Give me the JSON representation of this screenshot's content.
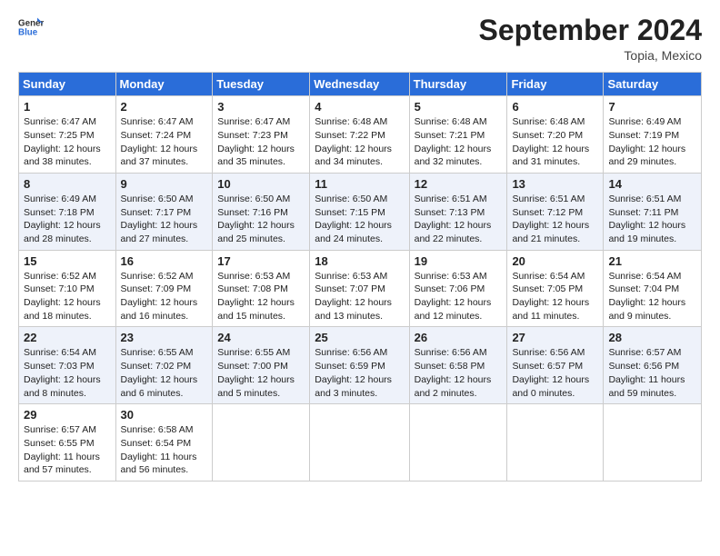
{
  "header": {
    "logo_general": "General",
    "logo_blue": "Blue",
    "month_year": "September 2024",
    "location": "Topia, Mexico"
  },
  "days_of_week": [
    "Sunday",
    "Monday",
    "Tuesday",
    "Wednesday",
    "Thursday",
    "Friday",
    "Saturday"
  ],
  "weeks": [
    [
      {
        "day": "1",
        "sunrise": "Sunrise: 6:47 AM",
        "sunset": "Sunset: 7:25 PM",
        "daylight": "Daylight: 12 hours and 38 minutes."
      },
      {
        "day": "2",
        "sunrise": "Sunrise: 6:47 AM",
        "sunset": "Sunset: 7:24 PM",
        "daylight": "Daylight: 12 hours and 37 minutes."
      },
      {
        "day": "3",
        "sunrise": "Sunrise: 6:47 AM",
        "sunset": "Sunset: 7:23 PM",
        "daylight": "Daylight: 12 hours and 35 minutes."
      },
      {
        "day": "4",
        "sunrise": "Sunrise: 6:48 AM",
        "sunset": "Sunset: 7:22 PM",
        "daylight": "Daylight: 12 hours and 34 minutes."
      },
      {
        "day": "5",
        "sunrise": "Sunrise: 6:48 AM",
        "sunset": "Sunset: 7:21 PM",
        "daylight": "Daylight: 12 hours and 32 minutes."
      },
      {
        "day": "6",
        "sunrise": "Sunrise: 6:48 AM",
        "sunset": "Sunset: 7:20 PM",
        "daylight": "Daylight: 12 hours and 31 minutes."
      },
      {
        "day": "7",
        "sunrise": "Sunrise: 6:49 AM",
        "sunset": "Sunset: 7:19 PM",
        "daylight": "Daylight: 12 hours and 29 minutes."
      }
    ],
    [
      {
        "day": "8",
        "sunrise": "Sunrise: 6:49 AM",
        "sunset": "Sunset: 7:18 PM",
        "daylight": "Daylight: 12 hours and 28 minutes."
      },
      {
        "day": "9",
        "sunrise": "Sunrise: 6:50 AM",
        "sunset": "Sunset: 7:17 PM",
        "daylight": "Daylight: 12 hours and 27 minutes."
      },
      {
        "day": "10",
        "sunrise": "Sunrise: 6:50 AM",
        "sunset": "Sunset: 7:16 PM",
        "daylight": "Daylight: 12 hours and 25 minutes."
      },
      {
        "day": "11",
        "sunrise": "Sunrise: 6:50 AM",
        "sunset": "Sunset: 7:15 PM",
        "daylight": "Daylight: 12 hours and 24 minutes."
      },
      {
        "day": "12",
        "sunrise": "Sunrise: 6:51 AM",
        "sunset": "Sunset: 7:13 PM",
        "daylight": "Daylight: 12 hours and 22 minutes."
      },
      {
        "day": "13",
        "sunrise": "Sunrise: 6:51 AM",
        "sunset": "Sunset: 7:12 PM",
        "daylight": "Daylight: 12 hours and 21 minutes."
      },
      {
        "day": "14",
        "sunrise": "Sunrise: 6:51 AM",
        "sunset": "Sunset: 7:11 PM",
        "daylight": "Daylight: 12 hours and 19 minutes."
      }
    ],
    [
      {
        "day": "15",
        "sunrise": "Sunrise: 6:52 AM",
        "sunset": "Sunset: 7:10 PM",
        "daylight": "Daylight: 12 hours and 18 minutes."
      },
      {
        "day": "16",
        "sunrise": "Sunrise: 6:52 AM",
        "sunset": "Sunset: 7:09 PM",
        "daylight": "Daylight: 12 hours and 16 minutes."
      },
      {
        "day": "17",
        "sunrise": "Sunrise: 6:53 AM",
        "sunset": "Sunset: 7:08 PM",
        "daylight": "Daylight: 12 hours and 15 minutes."
      },
      {
        "day": "18",
        "sunrise": "Sunrise: 6:53 AM",
        "sunset": "Sunset: 7:07 PM",
        "daylight": "Daylight: 12 hours and 13 minutes."
      },
      {
        "day": "19",
        "sunrise": "Sunrise: 6:53 AM",
        "sunset": "Sunset: 7:06 PM",
        "daylight": "Daylight: 12 hours and 12 minutes."
      },
      {
        "day": "20",
        "sunrise": "Sunrise: 6:54 AM",
        "sunset": "Sunset: 7:05 PM",
        "daylight": "Daylight: 12 hours and 11 minutes."
      },
      {
        "day": "21",
        "sunrise": "Sunrise: 6:54 AM",
        "sunset": "Sunset: 7:04 PM",
        "daylight": "Daylight: 12 hours and 9 minutes."
      }
    ],
    [
      {
        "day": "22",
        "sunrise": "Sunrise: 6:54 AM",
        "sunset": "Sunset: 7:03 PM",
        "daylight": "Daylight: 12 hours and 8 minutes."
      },
      {
        "day": "23",
        "sunrise": "Sunrise: 6:55 AM",
        "sunset": "Sunset: 7:02 PM",
        "daylight": "Daylight: 12 hours and 6 minutes."
      },
      {
        "day": "24",
        "sunrise": "Sunrise: 6:55 AM",
        "sunset": "Sunset: 7:00 PM",
        "daylight": "Daylight: 12 hours and 5 minutes."
      },
      {
        "day": "25",
        "sunrise": "Sunrise: 6:56 AM",
        "sunset": "Sunset: 6:59 PM",
        "daylight": "Daylight: 12 hours and 3 minutes."
      },
      {
        "day": "26",
        "sunrise": "Sunrise: 6:56 AM",
        "sunset": "Sunset: 6:58 PM",
        "daylight": "Daylight: 12 hours and 2 minutes."
      },
      {
        "day": "27",
        "sunrise": "Sunrise: 6:56 AM",
        "sunset": "Sunset: 6:57 PM",
        "daylight": "Daylight: 12 hours and 0 minutes."
      },
      {
        "day": "28",
        "sunrise": "Sunrise: 6:57 AM",
        "sunset": "Sunset: 6:56 PM",
        "daylight": "Daylight: 11 hours and 59 minutes."
      }
    ],
    [
      {
        "day": "29",
        "sunrise": "Sunrise: 6:57 AM",
        "sunset": "Sunset: 6:55 PM",
        "daylight": "Daylight: 11 hours and 57 minutes."
      },
      {
        "day": "30",
        "sunrise": "Sunrise: 6:58 AM",
        "sunset": "Sunset: 6:54 PM",
        "daylight": "Daylight: 11 hours and 56 minutes."
      },
      null,
      null,
      null,
      null,
      null
    ]
  ]
}
